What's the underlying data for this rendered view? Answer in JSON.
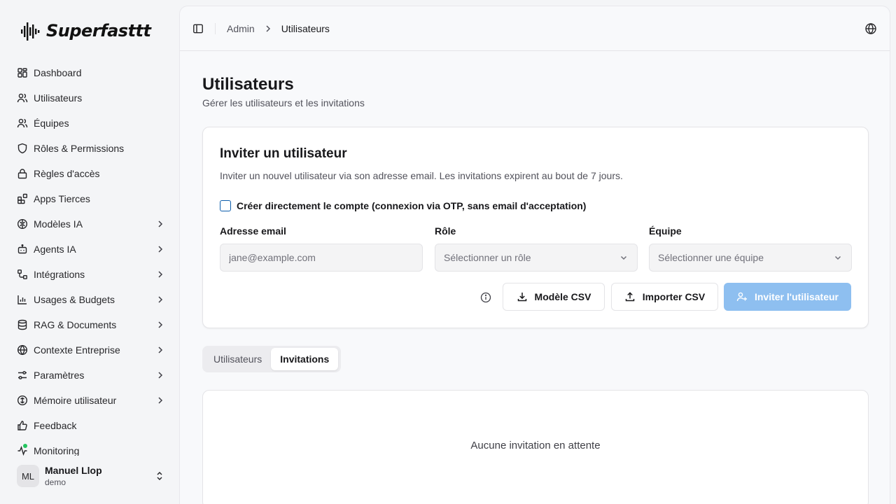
{
  "brand": {
    "name": "Superfasttt",
    "logo_icon": "soundwave-logo"
  },
  "sidebar": {
    "items": [
      {
        "label": "Dashboard",
        "icon": "layout-grid-icon",
        "has_children": false
      },
      {
        "label": "Utilisateurs",
        "icon": "users-icon",
        "has_children": false
      },
      {
        "label": "Équipes",
        "icon": "users-group-icon",
        "has_children": false
      },
      {
        "label": "Rôles & Permissions",
        "icon": "shield-icon",
        "has_children": false
      },
      {
        "label": "Règles d'accès",
        "icon": "lock-icon",
        "has_children": false
      },
      {
        "label": "Apps Tierces",
        "icon": "blocks-icon",
        "has_children": false
      },
      {
        "label": "Modèles IA",
        "icon": "brain-icon",
        "has_children": true
      },
      {
        "label": "Agents IA",
        "icon": "bot-icon",
        "has_children": true
      },
      {
        "label": "Intégrations",
        "icon": "workflow-icon",
        "has_children": true
      },
      {
        "label": "Usages & Budgets",
        "icon": "bar-chart-icon",
        "has_children": true
      },
      {
        "label": "RAG & Documents",
        "icon": "database-icon",
        "has_children": true
      },
      {
        "label": "Contexte Entreprise",
        "icon": "building-icon",
        "has_children": true
      },
      {
        "label": "Paramètres",
        "icon": "settings-sliders-icon",
        "has_children": true
      },
      {
        "label": "Mémoire utilisateur",
        "icon": "memory-icon",
        "has_children": true
      },
      {
        "label": "Feedback",
        "icon": "thumbs-up-icon",
        "has_children": false
      },
      {
        "label": "Monitoring",
        "icon": "activity-icon",
        "has_children": false
      }
    ],
    "user": {
      "initials": "ML",
      "name": "Manuel Llop",
      "subtitle": "demo"
    }
  },
  "header": {
    "breadcrumb": [
      "Admin",
      "Utilisateurs"
    ]
  },
  "page": {
    "title": "Utilisateurs",
    "subtitle": "Gérer les utilisateurs et les invitations"
  },
  "invite": {
    "title": "Inviter un utilisateur",
    "description": "Inviter un nouvel utilisateur via son adresse email. Les invitations expirent au bout de 7 jours.",
    "checkbox_label": "Créer directement le compte (connexion via OTP, sans email d'acceptation)",
    "checkbox_checked": false,
    "email_label": "Adresse email",
    "email_placeholder": "jane@example.com",
    "email_value": "",
    "role_label": "Rôle",
    "role_placeholder": "Sélectionner un rôle",
    "team_label": "Équipe",
    "team_placeholder": "Sélectionner une équipe",
    "csv_template_label": "Modèle CSV",
    "import_csv_label": "Importer CSV",
    "invite_button_label": "Inviter l'utilisateur"
  },
  "tabs": [
    {
      "label": "Utilisateurs",
      "active": false
    },
    {
      "label": "Invitations",
      "active": true
    }
  ],
  "invitations": {
    "empty_text": "Aucune invitation en attente"
  },
  "colors": {
    "primary_disabled": "#8ebff0",
    "checkbox_border": "#0b5cab",
    "status_green": "#22c55e"
  }
}
